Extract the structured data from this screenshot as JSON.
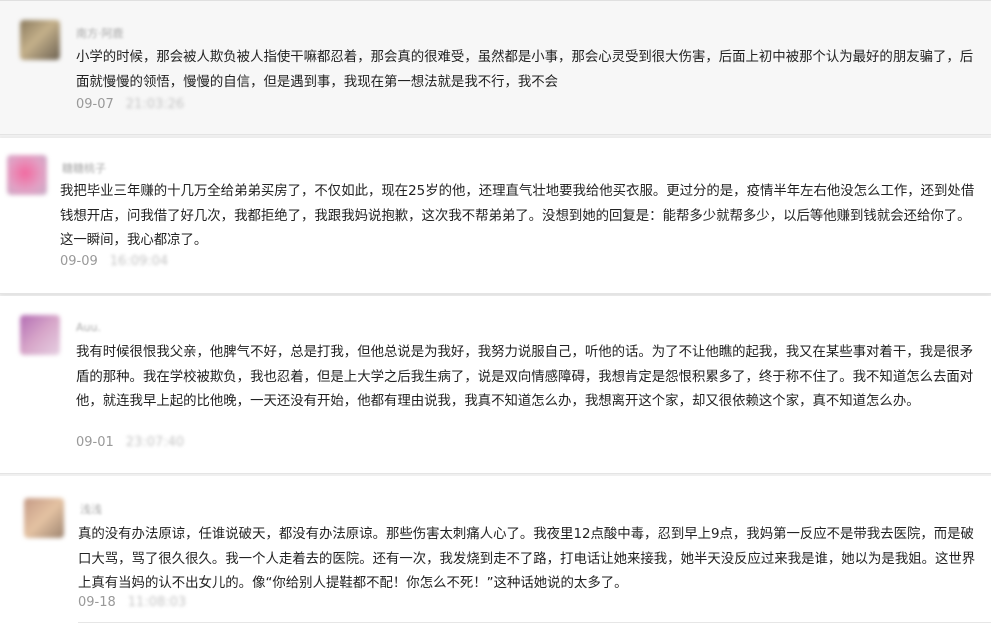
{
  "comments": [
    {
      "username": "南方·阿鹿",
      "content": "小学的时候，那会被人欺负被人指使干嘛都忍着，那会真的很难受，虽然都是小事，那会心灵受到很大伤害，后面上初中被那个认为最好的朋友骗了，后面就慢慢的领悟，慢慢的自信，但是遇到事，我现在第一想法就是我不行，我不会",
      "date": "09-07",
      "time": "21:03:26"
    },
    {
      "username": "糖糖桃子",
      "content": "我把毕业三年赚的十几万全给弟弟买房了，不仅如此，现在25岁的他，还理直气壮地要我给他买衣服。更过分的是，疫情半年左右他没怎么工作，还到处借钱想开店，问我借了好几次，我都拒绝了，我跟我妈说抱歉，这次我不帮弟弟了。没想到她的回复是：能帮多少就帮多少，以后等他赚到钱就会还给你了。这一瞬间，我心都凉了。",
      "date": "09-09",
      "time": "16:09:04"
    },
    {
      "username": "Auu.",
      "content": "我有时候很恨我父亲，他脾气不好，总是打我，但他总说是为我好，我努力说服自己，听他的话。为了不让他瞧的起我，我又在某些事对着干，我是很矛盾的那种。我在学校被欺负，我也忍着，但是上大学之后我生病了，说是双向情感障碍，我想肯定是怨恨积累多了，终于称不住了。我不知道怎么去面对他，就连我早上起的比他晚，一天还没有开始，他都有理由说我，我真不知道怎么办，我想离开这个家，却又很依赖这个家，真不知道怎么办。",
      "date": "09-01",
      "time": "23:07:40"
    },
    {
      "username": "浅浅",
      "content": "真的没有办法原谅，任谁说破天，都没有办法原谅。那些伤害太刺痛人心了。我夜里12点酸中毒，忍到早上9点，我妈第一反应不是带我去医院，而是破口大骂，骂了很久很久。我一个人走着去的医院。还有一次，我发烧到走不了路，打电话让她来接我，她半天没反应过来我是谁，她以为是我姐。这世界上真有当妈的认不出女儿的。像“你给别人提鞋都不配！你怎么不死！”这种话她说的太多了。",
      "date": "09-18",
      "time": "11:08:03"
    }
  ],
  "colors": {
    "background": "#f0f0f0",
    "text": "#222222",
    "meta": "#999999"
  }
}
